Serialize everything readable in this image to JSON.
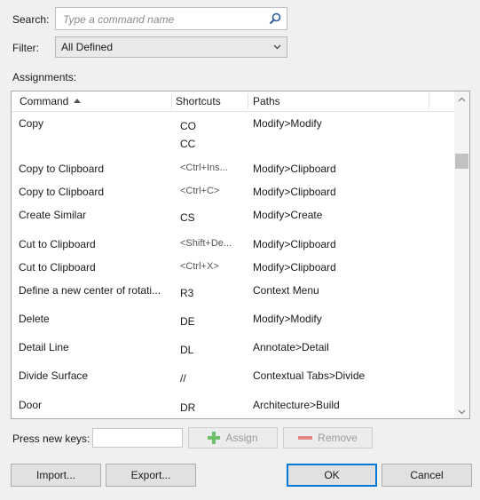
{
  "search": {
    "label": "Search:",
    "placeholder": "Type a command name"
  },
  "filter": {
    "label": "Filter:",
    "value": "All Defined"
  },
  "assignments": {
    "label": "Assignments:",
    "columns": {
      "command": "Command",
      "shortcuts": "Shortcuts",
      "paths": "Paths"
    },
    "rows": [
      {
        "command": "Copy",
        "shortcuts": [
          "CO",
          "CC"
        ],
        "path": "Modify>Modify"
      },
      {
        "command": "Copy to Clipboard",
        "shortcuts": [
          "<Ctrl+Ins..."
        ],
        "path": "Modify>Clipboard"
      },
      {
        "command": "Copy to Clipboard",
        "shortcuts": [
          "<Ctrl+C>"
        ],
        "path": "Modify>Clipboard"
      },
      {
        "command": "Create Similar",
        "shortcuts": [
          "CS"
        ],
        "path": "Modify>Create"
      },
      {
        "command": "Cut to Clipboard",
        "shortcuts": [
          "<Shift+De..."
        ],
        "path": "Modify>Clipboard"
      },
      {
        "command": "Cut to Clipboard",
        "shortcuts": [
          "<Ctrl+X>"
        ],
        "path": "Modify>Clipboard"
      },
      {
        "command": "Define a new center of rotati...",
        "shortcuts": [
          "R3"
        ],
        "path": "Context Menu"
      },
      {
        "command": "Delete",
        "shortcuts": [
          "DE"
        ],
        "path": "Modify>Modify"
      },
      {
        "command": "Detail Line",
        "shortcuts": [
          "DL"
        ],
        "path": "Annotate>Detail"
      },
      {
        "command": "Divide Surface",
        "shortcuts": [
          "//"
        ],
        "path": "Contextual Tabs>Divide"
      },
      {
        "command": "Door",
        "shortcuts": [
          "DR"
        ],
        "path": "Architecture>Build"
      }
    ]
  },
  "press_keys": {
    "label": "Press new keys:",
    "value": ""
  },
  "buttons": {
    "assign": "Assign",
    "remove": "Remove",
    "import": "Import...",
    "export": "Export...",
    "ok": "OK",
    "cancel": "Cancel"
  },
  "colors": {
    "accent": "#0078d7",
    "assign_icon": "#6cbf6c",
    "remove_icon": "#e38686"
  }
}
